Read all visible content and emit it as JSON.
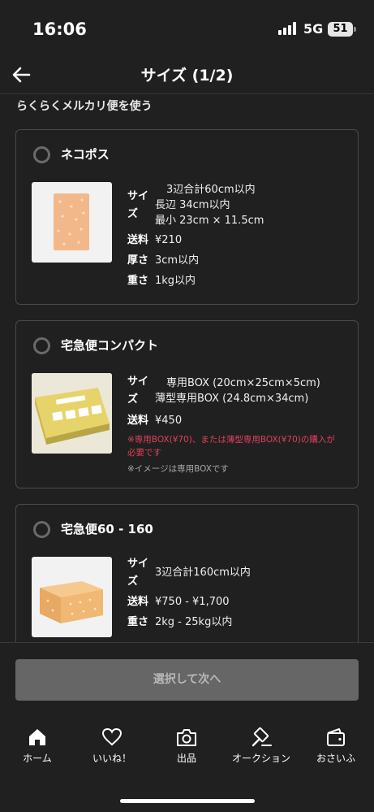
{
  "status": {
    "time": "16:06",
    "network": "5G",
    "battery": "51"
  },
  "header": {
    "title": "サイズ (1/2)"
  },
  "section": {
    "label": "らくらくメルカリ便を使う"
  },
  "options": [
    {
      "name": "ネコポス",
      "size_label": "サイズ",
      "size_lines": [
        "3辺合計60cm以内",
        "長辺 34cm以内",
        "最小 23cm × 11.5cm"
      ],
      "fee_label": "送料",
      "fee": "¥210",
      "thickness_label": "厚さ",
      "thickness": "3cm以内",
      "weight_label": "重さ",
      "weight": "1kg以内"
    },
    {
      "name": "宅急便コンパクト",
      "size_label": "サイズ",
      "size_lines": [
        "専用BOX (20cm×25cm×5cm)",
        "薄型専用BOX (24.8cm×34cm)"
      ],
      "fee_label": "送料",
      "fee": "¥450",
      "warning": "※専用BOX(¥70)、または薄型専用BOX(¥70)の購入が必要です",
      "note": "※イメージは専用BOXです"
    },
    {
      "name": "宅急便60 - 160",
      "size_label": "サイズ",
      "size_lines": [
        "3辺合計160cm以内"
      ],
      "fee_label": "送料",
      "fee": "¥750 - ¥1,700",
      "weight_label": "重さ",
      "weight": "2kg - 25kg以内"
    }
  ],
  "footer": {
    "next_label": "選択して次へ"
  },
  "tabs": [
    {
      "label": "ホーム",
      "icon": "home-icon"
    },
    {
      "label": "いいね！",
      "icon": "heart-icon"
    },
    {
      "label": "出品",
      "icon": "camera-icon"
    },
    {
      "label": "オークション",
      "icon": "gavel-icon"
    },
    {
      "label": "おさいふ",
      "icon": "wallet-icon"
    }
  ],
  "colors": {
    "background": "#202020",
    "warning": "#e0415a",
    "button_disabled": "#666666"
  }
}
